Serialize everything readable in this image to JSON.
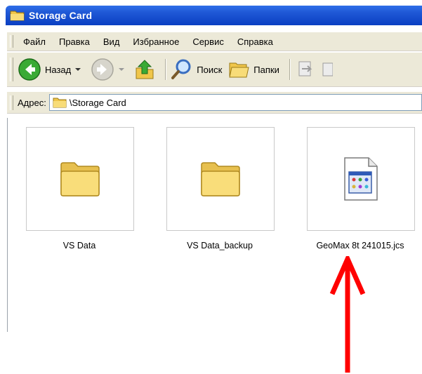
{
  "window": {
    "title": "Storage Card"
  },
  "menu": {
    "items": [
      "Файл",
      "Правка",
      "Вид",
      "Избранное",
      "Сервис",
      "Справка"
    ]
  },
  "toolbar": {
    "back_label": "Назад",
    "search_label": "Поиск",
    "folders_label": "Папки",
    "icons": [
      "back-arrow-icon",
      "forward-arrow-icon",
      "up-folder-icon",
      "search-icon",
      "folders-icon",
      "move-to-icon",
      "copy-to-icon"
    ]
  },
  "address": {
    "label": "Адрес:",
    "value": "\\Storage Card"
  },
  "files": [
    {
      "name": "VS Data",
      "type": "folder"
    },
    {
      "name": "VS Data_backup",
      "type": "folder"
    },
    {
      "name": "GeoMax 8t 241015.jcs",
      "type": "file"
    }
  ],
  "annotation": {
    "color": "#ff0000",
    "points_to": "GeoMax 8t 241015.jcs"
  },
  "colors": {
    "titlebar": "#1f58d6",
    "chrome": "#ece9d8",
    "folder": "#f5d76e"
  }
}
